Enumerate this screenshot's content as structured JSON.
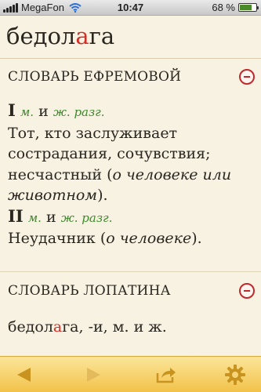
{
  "status_bar": {
    "carrier": "MegaFon",
    "time": "10:47",
    "battery": "68 %",
    "battery_level": 0.68
  },
  "word": {
    "before_stress": "бедол",
    "stressed": "а",
    "after_stress": "га"
  },
  "sections": [
    {
      "title": "СЛОВАРЬ ЕФРЕМОВОЙ",
      "senses": [
        {
          "number": "I",
          "gram1": "м.",
          "conj": "и",
          "gram2": "ж. разг.",
          "definition_part1": "Тот, кто заслуживает сострадания, сочувствия; несчастный (",
          "definition_italic": "о человеке или животном",
          "definition_part2": ")."
        },
        {
          "number": "II",
          "gram1": "м.",
          "conj": "и",
          "gram2": "ж. разг.",
          "definition_part1": "Неудачник (",
          "definition_italic": "о человеке",
          "definition_part2": ")."
        }
      ]
    },
    {
      "title": "СЛОВАРЬ ЛОПАТИНА",
      "entry_before_stress": "бедол",
      "entry_stressed": "а",
      "entry_after": "га, -и, м. и ж."
    }
  ],
  "toolbar": {
    "back_icon": "back-arrow-icon",
    "forward_icon": "forward-arrow-icon",
    "share_icon": "share-icon",
    "settings_icon": "gear-icon",
    "accent_color": "#c8931e"
  }
}
